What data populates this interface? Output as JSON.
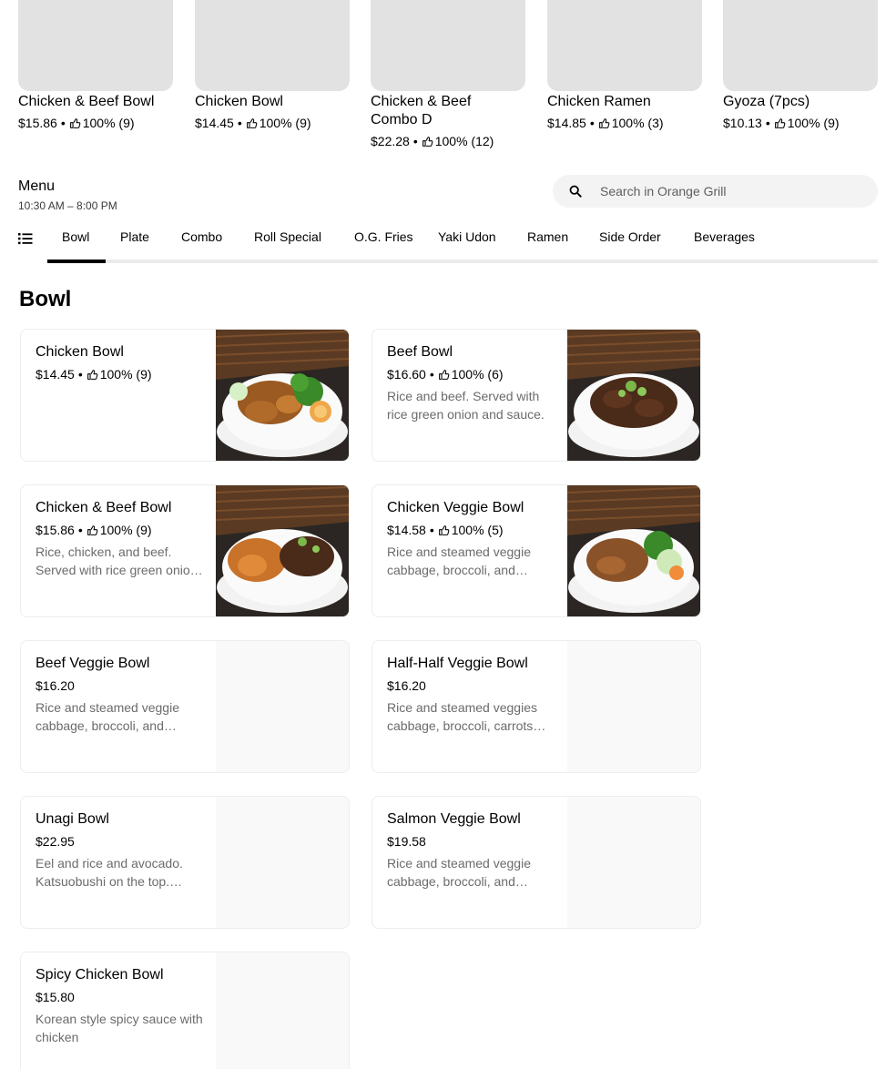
{
  "featured": [
    {
      "name": "Chicken & Beef Bowl",
      "price": "$15.86",
      "rating": "100% (9)"
    },
    {
      "name": "Chicken Bowl",
      "price": "$14.45",
      "rating": "100% (9)"
    },
    {
      "name": "Chicken & Beef Combo D",
      "price": "$22.28",
      "rating": "100% (12)"
    },
    {
      "name": "Chicken Ramen",
      "price": "$14.85",
      "rating": "100% (3)"
    },
    {
      "name": "Gyoza (7pcs)",
      "price": "$10.13",
      "rating": "100% (9)"
    }
  ],
  "menu": {
    "title": "Menu",
    "hours": "10:30 AM – 8:00 PM"
  },
  "search": {
    "placeholder": "Search in Orange Grill"
  },
  "tabs": [
    "Bowl",
    "Plate",
    "Combo",
    "Roll Special",
    "O.G. Fries",
    "Yaki Udon",
    "Ramen",
    "Side Order",
    "Beverages"
  ],
  "active_tab": "Bowl",
  "section": {
    "title": "Bowl"
  },
  "items": [
    {
      "name": "Chicken Bowl",
      "price": "$14.45",
      "dot": "•",
      "rating": "100% (9)",
      "desc": "",
      "image": "chicken-bowl-photo"
    },
    {
      "name": "Beef Bowl",
      "price": "$16.60",
      "dot": "•",
      "rating": "100% (6)",
      "desc": "Rice and beef. Served with rice green onion and sauce.",
      "image": "beef-bowl-photo"
    },
    {
      "name": "Chicken & Beef Bowl",
      "price": "$15.86",
      "dot": "•",
      "rating": "100% (9)",
      "desc": "Rice, chicken, and beef. Served with rice green onion and sauce.",
      "image": "chicken-beef-bowl-photo"
    },
    {
      "name": "Chicken Veggie Bowl",
      "price": "$14.58",
      "dot": "•",
      "rating": "100% (5)",
      "desc": "Rice and steamed veggie cabbage, broccoli, and carrots.",
      "image": "chicken-veggie-bowl-photo"
    },
    {
      "name": "Beef Veggie Bowl",
      "price": "$16.20",
      "dot": "",
      "rating": "",
      "desc": "Rice and steamed veggie cabbage, broccoli, and carrots.",
      "image": ""
    },
    {
      "name": "Half-Half Veggie Bowl",
      "price": "$16.20",
      "dot": "",
      "rating": "",
      "desc": "Rice and steamed veggies cabbage, broccoli, carrots and more.",
      "image": ""
    },
    {
      "name": "Unagi Bowl",
      "price": "$22.95",
      "dot": "",
      "rating": "",
      "desc": "Eel and rice and avocado. Katsuobushi on the top. Served with sauce.",
      "image": ""
    },
    {
      "name": "Salmon Veggie Bowl",
      "price": "$19.58",
      "dot": "",
      "rating": "",
      "desc": "Rice and steamed veggie cabbage, broccoli, and carrots.",
      "image": ""
    },
    {
      "name": "Spicy Chicken Bowl",
      "price": "$15.80",
      "dot": "",
      "rating": "",
      "desc": "Korean style spicy sauce with chicken",
      "image": ""
    }
  ],
  "colors": {
    "placeholder_gray": "#e2e2e2",
    "tab_active": "#000000",
    "tab_track": "#ebebeb",
    "desc_gray": "#6b6b6b",
    "search_bg": "#f3f3f3"
  }
}
